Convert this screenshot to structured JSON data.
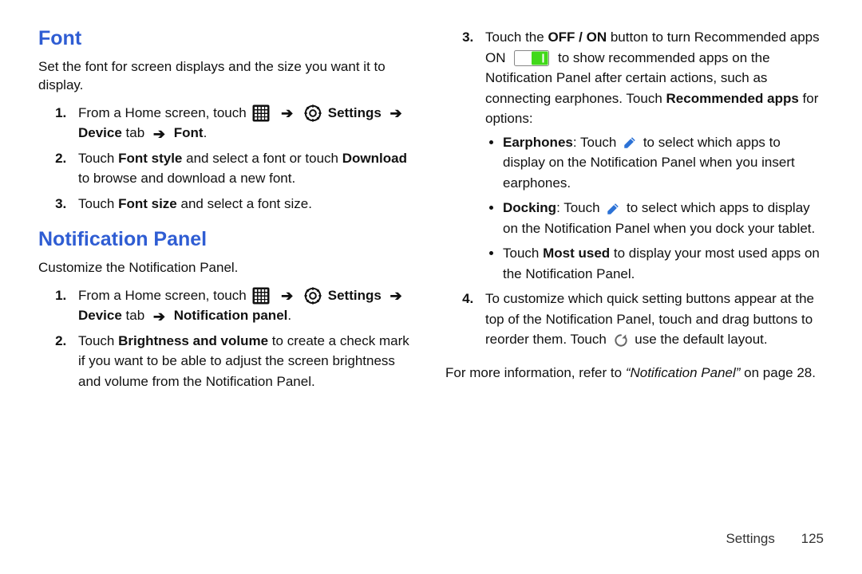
{
  "arrow": "➔",
  "footer": {
    "section": "Settings",
    "page": "125"
  },
  "left": {
    "font": {
      "heading": "Font",
      "intro": "Set the font for screen displays and the size you want it to display.",
      "step1_a": "From a Home screen, touch",
      "step1_settings": "Settings",
      "step1_device": "Device",
      "step1_tab": " tab ",
      "step1_font": "Font",
      "step1_end": ".",
      "step2_a": "Touch ",
      "step2_fontstyle": "Font style",
      "step2_b": " and select a font or touch ",
      "step2_download": "Download",
      "step2_c": " to browse and download a new font.",
      "step3_a": "Touch ",
      "step3_fontsize": "Font size",
      "step3_b": " and select a font size."
    },
    "np": {
      "heading": "Notification Panel",
      "intro": "Customize the Notification Panel.",
      "step1_a": "From a Home screen, touch",
      "step1_settings": "Settings",
      "step1_device": "Device",
      "step1_tab": " tab ",
      "step1_np": "Notification panel",
      "step1_end": ".",
      "step2_a": "Touch ",
      "step2_bv": "Brightness and volume",
      "step2_b": " to create a check mark if you want to be able to adjust the screen brightness and volume from the Notification Panel."
    }
  },
  "right": {
    "step3": {
      "a": "Touch the ",
      "offon": "OFF / ON",
      "b": " button to turn Recommended apps ON ",
      "c": " to show recommended apps on the Notification Panel after certain actions, such as connecting earphones. Touch ",
      "recapps": "Recommended apps",
      "d": " for options:",
      "ear_label": "Earphones",
      "ear_a": ": Touch ",
      "ear_b": " to select which apps to display on the Notification Panel when you insert earphones.",
      "dock_label": "Docking",
      "dock_a": ": Touch ",
      "dock_b": " to select which apps to display on the Notification Panel when you dock your tablet.",
      "most_a": "Touch ",
      "most_label": "Most used",
      "most_b": " to display your most used apps on the Notification Panel."
    },
    "step4": {
      "a": "To customize which quick setting buttons appear at the top of the Notification Panel, touch and drag buttons to reorder them. Touch ",
      "b": " use the default layout."
    },
    "ref_a": "For more information, refer to ",
    "ref_title": "“Notification Panel”",
    "ref_b": " on page 28."
  }
}
